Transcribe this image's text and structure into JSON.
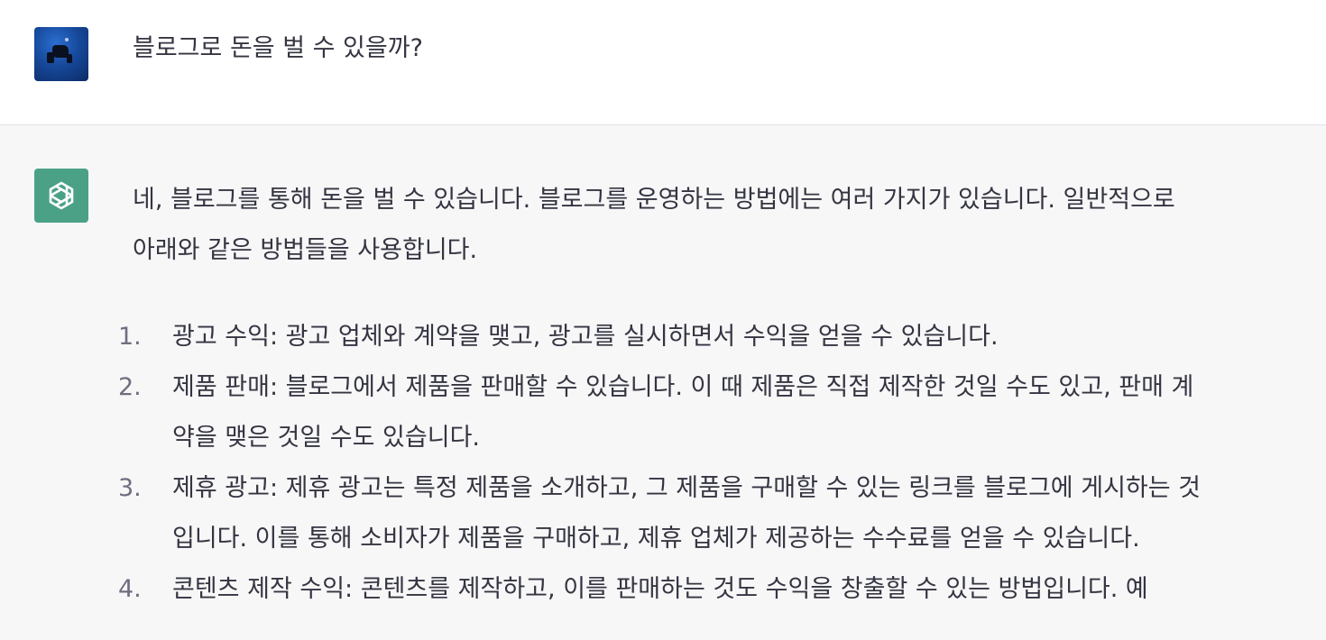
{
  "user_message": {
    "text": "블로그로 돈을 벌 수 있을까?"
  },
  "assistant_message": {
    "intro_lines": [
      "네, 블로그를 통해 돈을 벌 수 있습니다. 블로그를 운영하는 방법에는 여러 가지가 있습니다. 일반적으로",
      "아래와 같은 방법들을 사용합니다."
    ],
    "list": [
      {
        "number": "1.",
        "lines": [
          "광고 수익: 광고 업체와 계약을 맺고, 광고를 실시하면서 수익을 얻을 수 있습니다."
        ]
      },
      {
        "number": "2.",
        "lines": [
          "제품 판매: 블로그에서 제품을 판매할 수 있습니다. 이 때 제품은 직접 제작한 것일 수도 있고, 판매 계",
          "약을 맺은 것일 수도 있습니다."
        ]
      },
      {
        "number": "3.",
        "lines": [
          "제휴 광고: 제휴 광고는 특정 제품을 소개하고, 그 제품을 구매할 수 있는 링크를 블로그에 게시하는 것",
          "입니다. 이를 통해 소비자가 제품을 구매하고, 제휴 업체가 제공하는 수수료를 얻을 수 있습니다."
        ]
      },
      {
        "number": "4.",
        "lines": [
          "콘텐츠 제작 수익: 콘텐츠를 제작하고, 이를 판매하는 것도 수익을 창출할 수 있는 방법입니다. 예"
        ]
      }
    ]
  },
  "colors": {
    "user_bg": "#ffffff",
    "assistant_bg": "#f7f7f8",
    "text": "#343541",
    "number": "#6e6e80",
    "gpt_avatar": "#4aa186"
  },
  "icons": {
    "user_avatar": "scuba-diver-photo-avatar",
    "assistant_avatar": "openai-logo-icon"
  }
}
